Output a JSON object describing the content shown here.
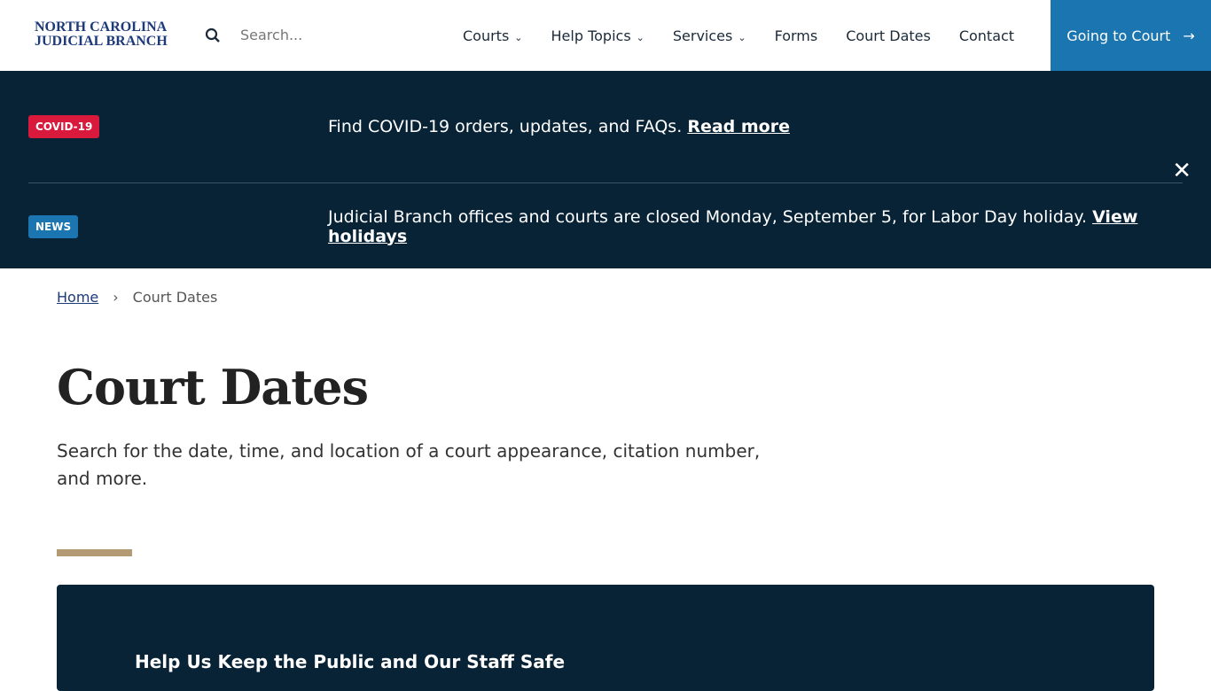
{
  "header": {
    "logo": "NORTH CAROLINA JUDICIAL BRANCH",
    "logo_line1": "NORTH CAROLINA",
    "logo_line2": "JUDICIAL BRANCH",
    "search_placeholder": "Search...",
    "nav": [
      "Courts",
      "Help Topics",
      "Services",
      "Forms",
      "Court Dates",
      "Contact"
    ],
    "cta": "Going to Court"
  },
  "alerts": [
    {
      "badge": "COVID-19",
      "badge_color": "#d91a3c",
      "text": "Find COVID-19 orders, updates, and FAQs.",
      "link": "Read more"
    },
    {
      "badge": "NEWS",
      "badge_color": "#1a75b0",
      "text": "Judicial Branch offices and courts are closed Monday, September 5, for Labor Day holiday.",
      "link": "View holidays"
    }
  ],
  "breadcrumb": {
    "home": "Home",
    "current": "Court Dates"
  },
  "page": {
    "title": "Court Dates",
    "description": "Search for the date, time, and location of a court appearance, citation number, and more.",
    "panel_title": "Help Us Keep the Public and Our Staff Safe"
  }
}
